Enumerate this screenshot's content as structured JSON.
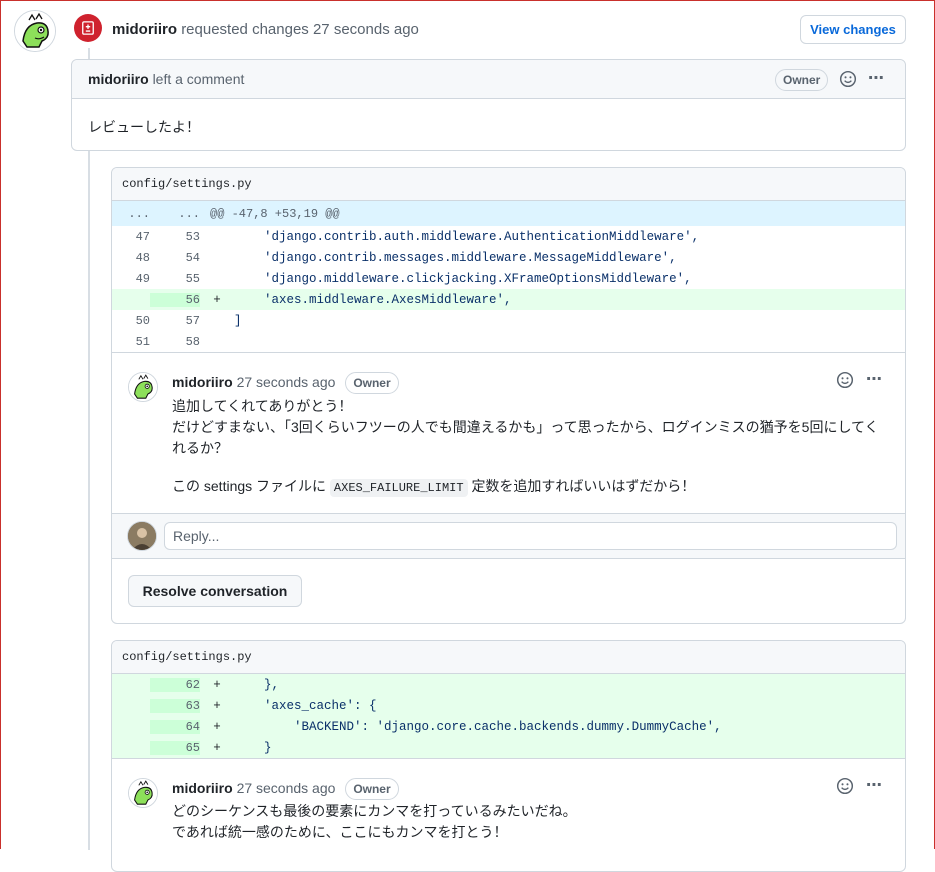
{
  "event": {
    "author": "midoriiro",
    "action": "requested changes",
    "time": "27 seconds ago",
    "view_changes": "View changes"
  },
  "review": {
    "author": "midoriiro",
    "action": "left a comment",
    "badge": "Owner",
    "body": "レビューしたよ！"
  },
  "file1": {
    "name": "config/settings.py",
    "hunk_left": "...",
    "hunk_right": "...",
    "hunk_header": "@@ -47,8 +53,19 @@",
    "lines": [
      {
        "old": "47",
        "new": "53",
        "sign": "",
        "code": "    'django.contrib.auth.middleware.AuthenticationMiddleware',"
      },
      {
        "old": "48",
        "new": "54",
        "sign": "",
        "code": "    'django.contrib.messages.middleware.MessageMiddleware',"
      },
      {
        "old": "49",
        "new": "55",
        "sign": "",
        "code": "    'django.middleware.clickjacking.XFrameOptionsMiddleware',"
      },
      {
        "old": "",
        "new": "56",
        "sign": "+",
        "code": "    'axes.middleware.AxesMiddleware',"
      },
      {
        "old": "50",
        "new": "57",
        "sign": "",
        "code": "]"
      },
      {
        "old": "51",
        "new": "58",
        "sign": "",
        "code": ""
      }
    ],
    "comment": {
      "author": "midoriiro",
      "time": "27 seconds ago",
      "badge": "Owner",
      "line1": "追加してくれてありがとう！",
      "line2": "だけどすまない、「3回くらいフツーの人でも間違えるかも」って思ったから、ログインミスの猶予を5回にしてくれるか？",
      "line3_pre": "この settings ファイルに",
      "line3_code": "AXES_FAILURE_LIMIT",
      "line3_post": "定数を追加すればいいはずだから！"
    },
    "reply_placeholder": "Reply...",
    "resolve": "Resolve conversation"
  },
  "file2": {
    "name": "config/settings.py",
    "lines": [
      {
        "old": "",
        "new": "62",
        "sign": "+",
        "code": "    },"
      },
      {
        "old": "",
        "new": "63",
        "sign": "+",
        "code": "    'axes_cache': {"
      },
      {
        "old": "",
        "new": "64",
        "sign": "+",
        "code": "        'BACKEND': 'django.core.cache.backends.dummy.DummyCache',"
      },
      {
        "old": "",
        "new": "65",
        "sign": "+",
        "code": "    }"
      }
    ],
    "comment": {
      "author": "midoriiro",
      "time": "27 seconds ago",
      "badge": "Owner",
      "line1": "どのシーケンスも最後の要素にカンマを打っているみたいだね。",
      "line2": "であれば統一感のために、ここにもカンマを打とう！"
    }
  },
  "colors": {
    "accent": "#0969da",
    "danger": "#cf222e",
    "addition_bg": "#e6ffec",
    "hunk_bg": "#ddf4ff"
  }
}
